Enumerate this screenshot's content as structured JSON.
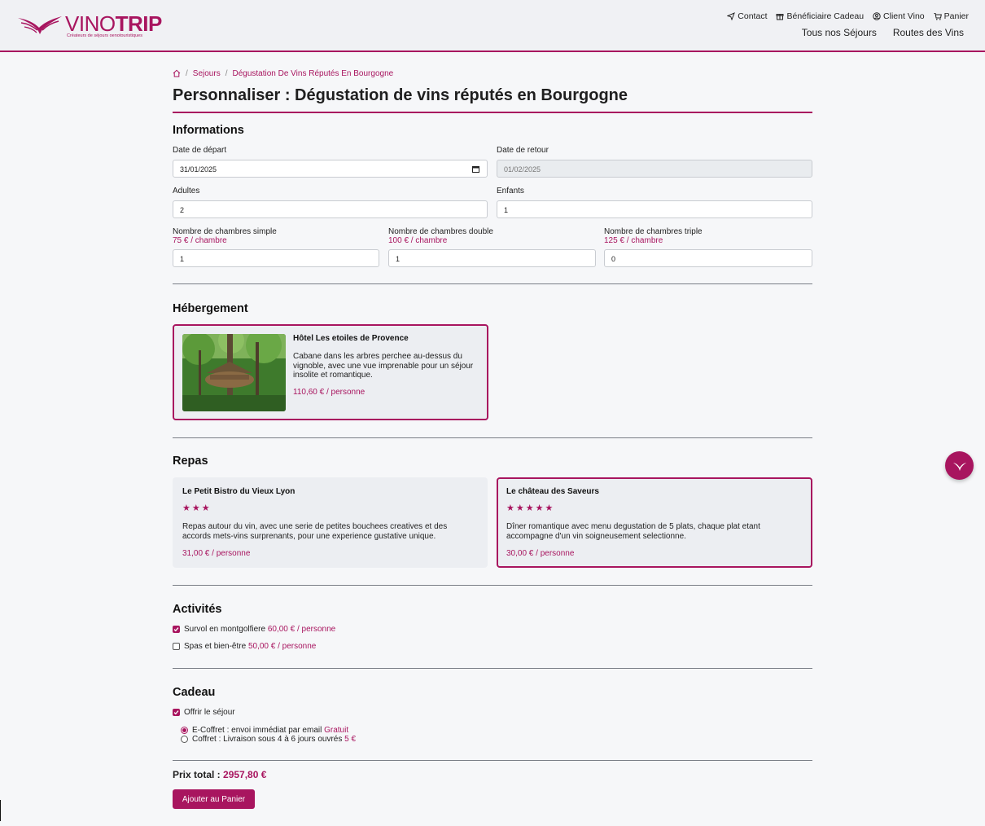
{
  "brand": {
    "name_a": "VINO",
    "name_b": "TRIP",
    "tagline": "Créateurs de séjours oenotouristiques"
  },
  "top_links": [
    {
      "label": "Contact",
      "icon": "send-icon"
    },
    {
      "label": "Bénéficiaire Cadeau",
      "icon": "gift-icon"
    },
    {
      "label": "Client Vino",
      "icon": "user-circle-icon"
    },
    {
      "label": "Panier",
      "icon": "cart-icon"
    }
  ],
  "main_nav": [
    "Tous nos Séjours",
    "Routes des Vins"
  ],
  "breadcrumb": {
    "home_icon": "home-icon",
    "items": [
      "Sejours",
      "Dégustation De Vins Réputés En Bourgogne"
    ]
  },
  "page_title": "Personnaliser : Dégustation de vins réputés en Bourgogne",
  "informations": {
    "heading": "Informations",
    "date_depart_label": "Date de départ",
    "date_depart_value": "31/01/2025",
    "date_retour_label": "Date de retour",
    "date_retour_value": "01/02/2025",
    "adultes_label": "Adultes",
    "adultes_value": "2",
    "enfants_label": "Enfants",
    "enfants_value": "1",
    "rooms": [
      {
        "label": "Nombre de chambres simple",
        "price": "75 € / chambre",
        "value": "1"
      },
      {
        "label": "Nombre de chambres double",
        "price": "100 € / chambre",
        "value": "1"
      },
      {
        "label": "Nombre de chambres triple",
        "price": "125 € / chambre",
        "value": "0"
      }
    ]
  },
  "hebergement": {
    "heading": "Hébergement",
    "hotel": {
      "name": "Hôtel Les etoiles de Provence",
      "description": "Cabane dans les arbres perchee au-dessus du vignoble, avec une vue imprenable pour un séjour insolite et romantique.",
      "price": "110,60 € / personne",
      "selected": true
    }
  },
  "repas": {
    "heading": "Repas",
    "items": [
      {
        "name": "Le Petit Bistro du Vieux Lyon",
        "stars": "★★★",
        "description": "Repas autour du vin, avec une serie de petites bouchees creatives et des accords mets-vins surprenants, pour une experience gustative unique.",
        "price": "31,00 € / personne",
        "selected": false
      },
      {
        "name": "Le château des Saveurs",
        "stars": "★★★★★",
        "description": "Dîner romantique avec menu degustation de 5 plats, chaque plat etant accompagne d'un vin soigneusement selectionne.",
        "price": "30,00 € / personne",
        "selected": true
      }
    ]
  },
  "activites": {
    "heading": "Activités",
    "items": [
      {
        "label": "Survol en montgolfiere",
        "price": "60,00 € / personne",
        "checked": true
      },
      {
        "label": "Spas et bien-être",
        "price": "50,00 € / personne",
        "checked": false
      }
    ]
  },
  "cadeau": {
    "heading": "Cadeau",
    "offrir_label": "Offrir le séjour",
    "offrir_checked": true,
    "options": [
      {
        "label": "E-Coffret : envoi immédiat par email",
        "price": "Gratuit",
        "selected": true
      },
      {
        "label": "Coffret : Livraison sous 4 à 6 jours ouvrés",
        "price": "5 €",
        "selected": false
      }
    ]
  },
  "total": {
    "label": "Prix total :",
    "value": "2957,80 €"
  },
  "add_to_cart_label": "Ajouter au Panier",
  "colors": {
    "accent": "#a8155f",
    "background": "#f6f7f9",
    "card": "#eceef2"
  }
}
